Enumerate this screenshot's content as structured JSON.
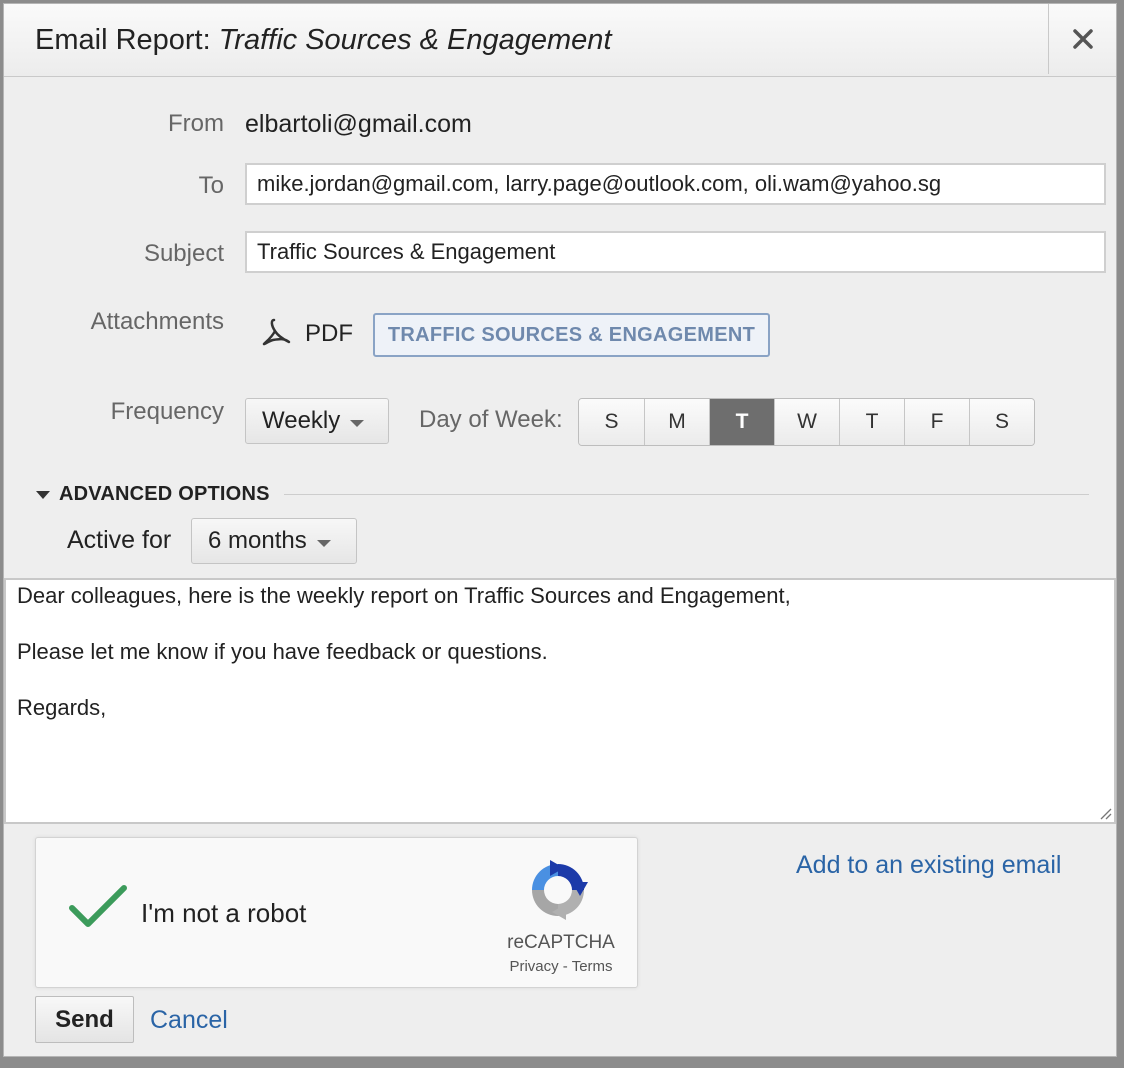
{
  "dialog": {
    "title_prefix": "Email Report: ",
    "title_report": "Traffic Sources & Engagement",
    "close_icon": "close-icon"
  },
  "form": {
    "from_label": "From",
    "from_value": "elbartoli@gmail.com",
    "to_label": "To",
    "to_value": "mike.jordan@gmail.com, larry.page@outlook.com, oli.wam@yahoo.sg",
    "subject_label": "Subject",
    "subject_value": "Traffic Sources & Engagement",
    "attachments_label": "Attachments",
    "attachment_icon": "pdf-icon",
    "attachment_format": "PDF",
    "attachment_name": "TRAFFIC SOURCES & ENGAGEMENT",
    "frequency_label": "Frequency",
    "frequency_value": "Weekly",
    "day_of_week_label": "Day of Week:",
    "days": [
      {
        "label": "S",
        "selected": false
      },
      {
        "label": "M",
        "selected": false
      },
      {
        "label": "T",
        "selected": true
      },
      {
        "label": "W",
        "selected": false
      },
      {
        "label": "T",
        "selected": false
      },
      {
        "label": "F",
        "selected": false
      },
      {
        "label": "S",
        "selected": false
      }
    ]
  },
  "advanced": {
    "label": "ADVANCED OPTIONS",
    "active_for_label": "Active for",
    "active_for_value": "6 months"
  },
  "message": {
    "line1": "Dear colleagues, here is the weekly report on Traffic Sources and Engagement,",
    "line2": "Please let me know if you have feedback or questions.",
    "line3": "Regards,"
  },
  "captcha": {
    "checkbox_label": "I'm not a robot",
    "checked": true,
    "brand": "reCAPTCHA",
    "privacy": "Privacy",
    "separator": " - ",
    "terms": "Terms"
  },
  "actions": {
    "add_to_existing": "Add to an existing email",
    "send": "Send",
    "cancel": "Cancel"
  },
  "colors": {
    "link": "#2a64a6",
    "selected_day": "#6e6e6e",
    "check": "#3c9b5b",
    "attachment_border": "#8aa3c5"
  }
}
